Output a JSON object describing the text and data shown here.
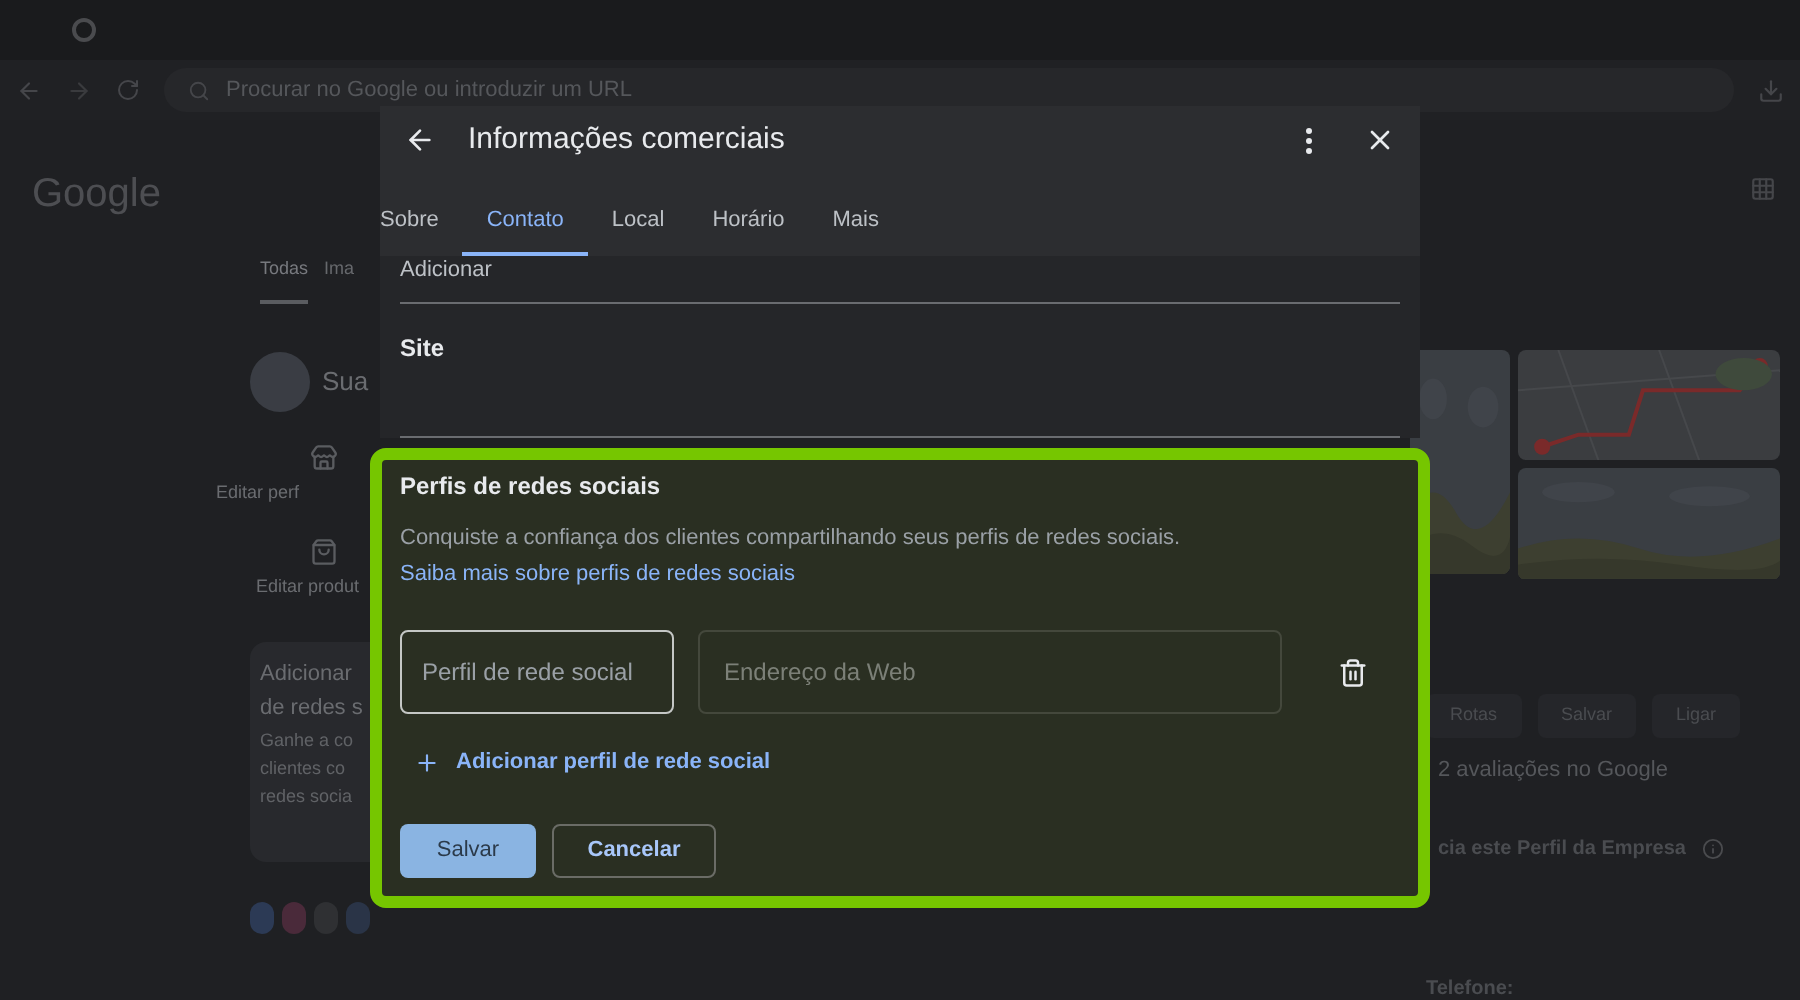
{
  "browser": {
    "address_placeholder": "Procurar no Google ou introduzir um URL"
  },
  "background": {
    "logo": "Google",
    "tabs": [
      {
        "label": "Todas",
        "selected": true
      },
      {
        "label": "Ima",
        "selected": false
      }
    ],
    "profile_name": "Sua",
    "actions": [
      "Editar perf",
      "Editar produt"
    ],
    "card_title_lines": [
      "Adicionar",
      "de redes s"
    ],
    "card_text_lines": [
      "Ganhe a co",
      "clientes co",
      "redes socia"
    ],
    "buttons": [
      "Rotas",
      "Salvar",
      "Ligar"
    ],
    "reviews": "2 avaliações no Google",
    "manage": "cia este Perfil da Empresa",
    "phone_label": "Telefone:"
  },
  "dialog": {
    "title": "Informações comerciais",
    "tabs": [
      {
        "label": "Sobre",
        "selected": false
      },
      {
        "label": "Contato",
        "selected": true
      },
      {
        "label": "Local",
        "selected": false
      },
      {
        "label": "Horário",
        "selected": false
      },
      {
        "label": "Mais",
        "selected": false
      }
    ],
    "fields": [
      {
        "label": "Adicionar"
      },
      {
        "label": "Site"
      }
    ],
    "social": {
      "title": "Perfis de redes sociais",
      "description": "Conquiste a confiança dos clientes compartilhando seus perfis de redes sociais.",
      "link": "Saiba mais sobre perfis de redes sociais",
      "profile_select": "Perfil de rede social",
      "web_placeholder": "Endereço da Web",
      "add": "Adicionar perfil de rede social",
      "save": "Salvar",
      "cancel": "Cancelar"
    }
  }
}
